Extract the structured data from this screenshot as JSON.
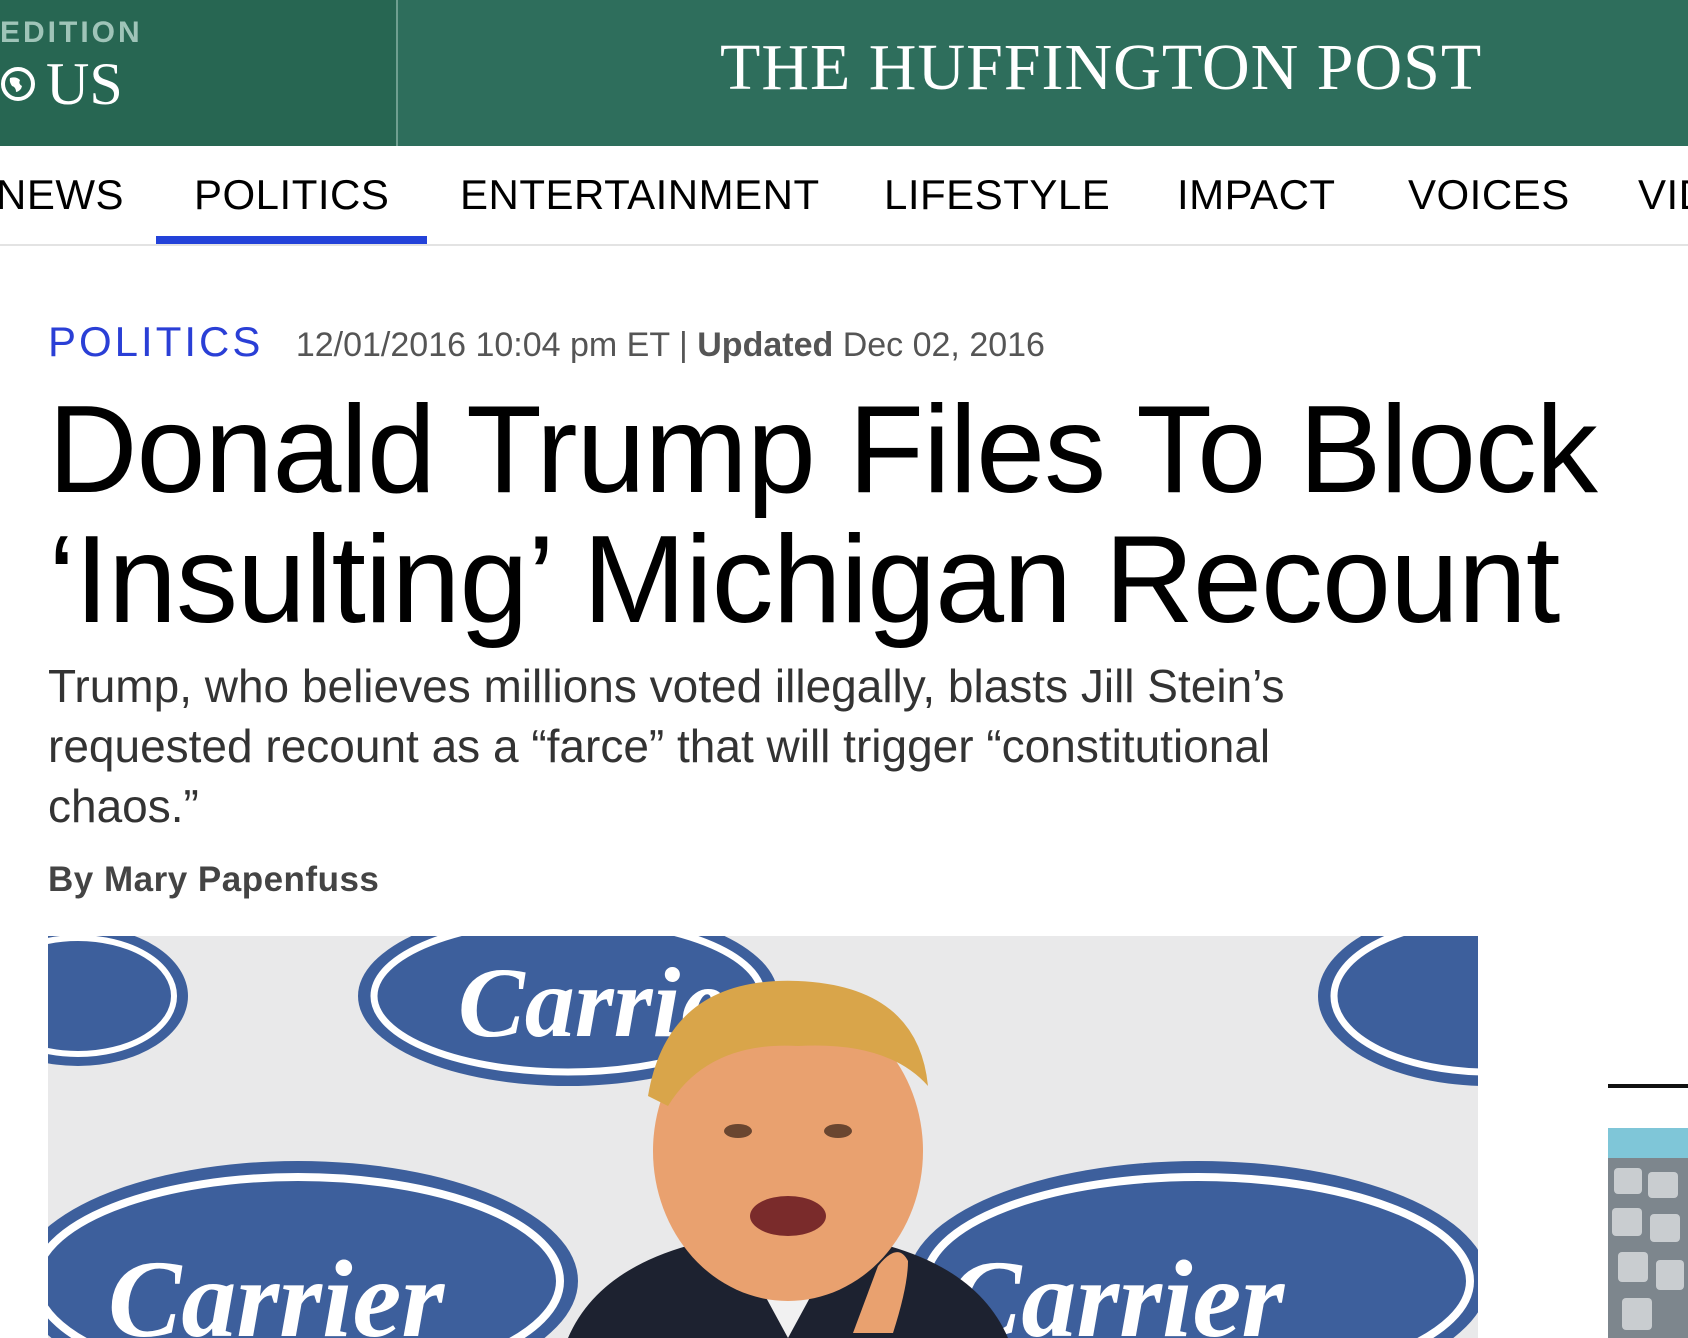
{
  "edition": {
    "label": "EDITION",
    "value": "US"
  },
  "site_title": "THE HUFFINGTON POST",
  "nav": {
    "items": [
      "NEWS",
      "POLITICS",
      "ENTERTAINMENT",
      "LIFESTYLE",
      "IMPACT",
      "VOICES",
      "VID"
    ],
    "active": "POLITICS"
  },
  "article": {
    "section": "POLITICS",
    "published": "12/01/2016 10:04 pm ET",
    "separator": "|",
    "updated_label": "Updated",
    "updated_date": "Dec 02, 2016",
    "headline_line1": "Donald Trump Files To Block",
    "headline_line2": "‘Insulting’ Michigan Recount",
    "dek_line1": "Trump, who believes millions voted illegally, blasts Jill Stein’s",
    "dek_line2": "requested recount as a “farce” that will trigger “constitutional",
    "dek_line3": "chaos.”",
    "byline": "By Mary Papenfuss"
  },
  "hero_image": {
    "backdrop_logo_text": "Carrier",
    "colors": {
      "backdrop": "#e9e9ea",
      "logo_fill": "#3d5f9c",
      "suit": "#1d2230",
      "hair": "#d9a54a",
      "skin": "#e9a16f"
    }
  },
  "colors": {
    "banner": "#2e6e5c",
    "edition_box": "#276652",
    "accent_blue": "#2a3fd6",
    "nav_underline": "#2342d9"
  }
}
